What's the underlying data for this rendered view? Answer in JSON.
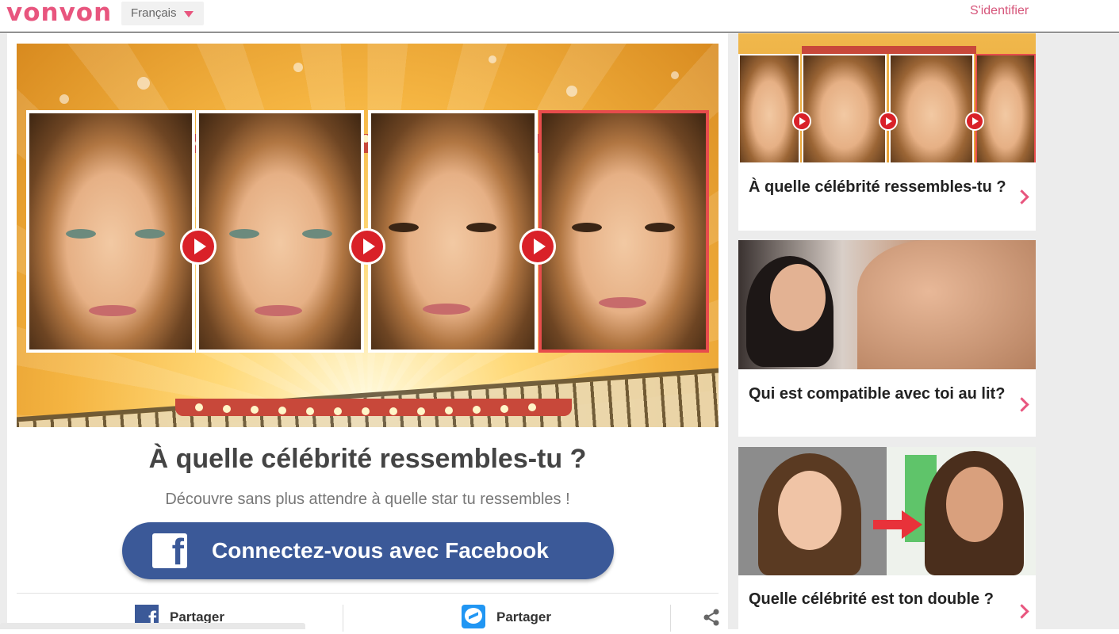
{
  "header": {
    "logo": "vonvon",
    "language": "Français",
    "login": "S'identifier"
  },
  "quiz": {
    "title": "À quelle célébrité ressembles-tu ?",
    "subtitle": "Découvre sans plus attendre à quelle star tu ressembles !",
    "facebook_button": "Connectez-vous avec Facebook"
  },
  "share": {
    "facebook_label": "Partager",
    "messenger_label": "Partager"
  },
  "sidebar": {
    "cards": [
      {
        "title": "À quelle célébrité ressembles-tu ?"
      },
      {
        "title": "Qui est compatible avec toi au lit?"
      },
      {
        "title": "Quelle célébrité est ton double ?"
      }
    ]
  },
  "colors": {
    "brand_pink": "#e8557e",
    "facebook_blue": "#3b5998",
    "messenger_blue": "#2196f3",
    "play_red": "#d92128"
  }
}
